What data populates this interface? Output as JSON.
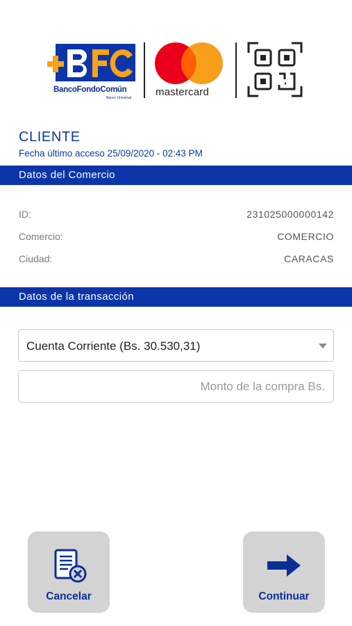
{
  "logos": {
    "bank_name": "BancoFondoComún",
    "bank_subtitle": "Banco Universal",
    "card_brand": "mastercard"
  },
  "client": {
    "title": "CLIENTE",
    "last_access": "Fecha último acceso 25/09/2020 - 02:43 PM"
  },
  "merchant_section": {
    "header": "Datos del Comercio",
    "rows": [
      {
        "label": "ID:",
        "value": "231025000000142"
      },
      {
        "label": "Comercio:",
        "value": "COMERCIO"
      },
      {
        "label": "Ciudad:",
        "value": "CARACAS"
      }
    ]
  },
  "transaction_section": {
    "header": "Datos de la transacción",
    "account_select": {
      "selected": "Cuenta Corriente (Bs. 30.530,31)"
    },
    "amount_input": {
      "value": "",
      "placeholder": "Monto de la compra Bs."
    }
  },
  "actions": {
    "cancel_label": "Cancelar",
    "cancel_icon": "document-cancel-icon",
    "continue_label": "Continuar",
    "continue_icon": "arrow-right-icon"
  },
  "colors": {
    "primary_blue": "#0b35a8",
    "brand_orange": "#f7a21b",
    "mc_red": "#eb001b",
    "mc_yellow": "#f79e1b",
    "button_gray": "#d3d3d3"
  }
}
